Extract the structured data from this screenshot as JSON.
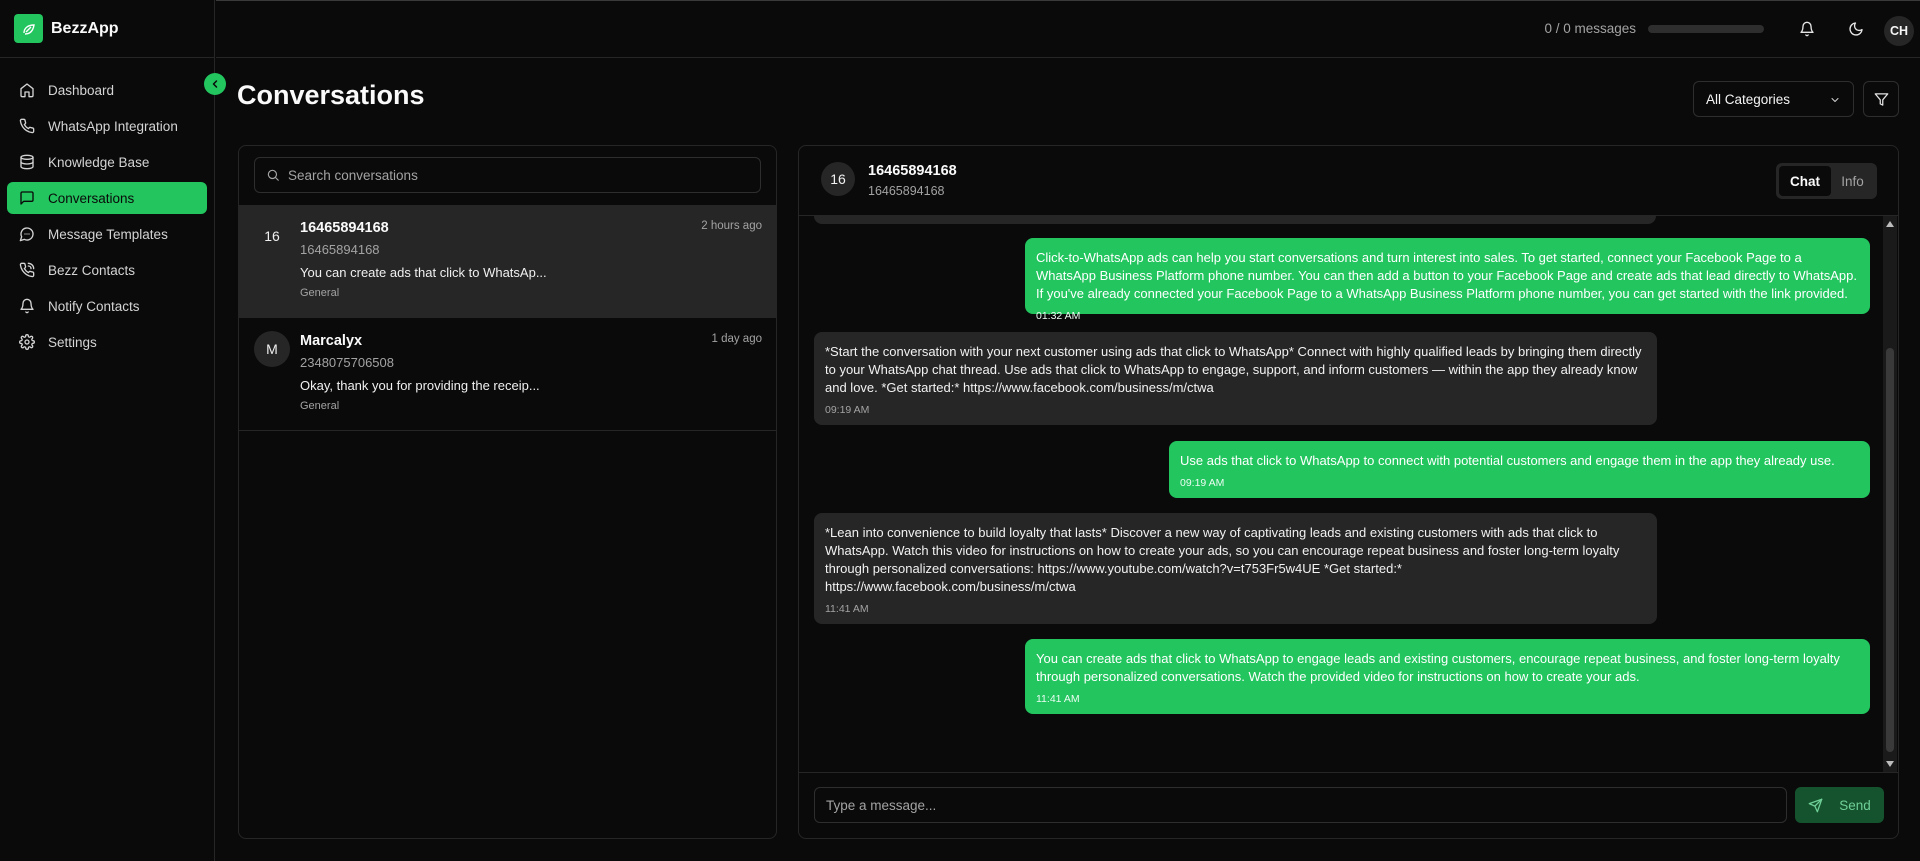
{
  "app": {
    "name": "BezzApp",
    "logo_icon": "leaf-chat-icon"
  },
  "colors": {
    "accent": "#22c55e",
    "background": "#0a0a0a",
    "surface": "#262626",
    "muted_text": "#a3a3a3"
  },
  "sidebar": {
    "items": [
      {
        "label": "Dashboard",
        "icon": "home-icon",
        "active": false
      },
      {
        "label": "WhatsApp Integration",
        "icon": "phone-icon",
        "active": false
      },
      {
        "label": "Knowledge Base",
        "icon": "database-icon",
        "active": false
      },
      {
        "label": "Conversations",
        "icon": "message-square-icon",
        "active": true
      },
      {
        "label": "Message Templates",
        "icon": "message-circle-icon",
        "active": false
      },
      {
        "label": "Bezz Contacts",
        "icon": "phone-call-icon",
        "active": false
      },
      {
        "label": "Notify Contacts",
        "icon": "bell-icon",
        "active": false
      },
      {
        "label": "Settings",
        "icon": "gear-icon",
        "active": false
      }
    ]
  },
  "topbar": {
    "usage_text": "0 / 0 messages",
    "usage_fraction": 0,
    "avatar_initials": "CH"
  },
  "page": {
    "title": "Conversations",
    "category_select": "All Categories"
  },
  "search": {
    "placeholder": "Search conversations",
    "value": ""
  },
  "conversations": [
    {
      "avatar": "16",
      "name": "16465894168",
      "phone": "16465894168",
      "preview": "You can create ads that click to WhatsAp...",
      "tag": "General",
      "time": "2 hours ago",
      "selected": true
    },
    {
      "avatar": "M",
      "name": "Marcalyx",
      "phone": "2348075706508",
      "preview": "Okay, thank you for providing the receip...",
      "tag": "General",
      "time": "1 day ago",
      "selected": false
    }
  ],
  "chat": {
    "avatar": "16",
    "name": "16465894168",
    "phone": "16465894168",
    "tabs": {
      "chat": "Chat",
      "info": "Info"
    },
    "messages": [
      {
        "direction": "out",
        "text": "Click-to-WhatsApp ads can help you start conversations and turn interest into sales. To get started, connect your Facebook Page to a WhatsApp Business Platform phone number. You can then add a button to your Facebook Page and create ads that lead directly to WhatsApp. If you've already connected your Facebook Page to a WhatsApp Business Platform phone number, you can get started with the link provided.",
        "time": "01:32 AM"
      },
      {
        "direction": "in",
        "text": "*Start the conversation with your next customer using ads that click to WhatsApp* Connect with highly qualified leads by bringing them directly to your WhatsApp chat thread. Use ads that click to WhatsApp to engage, support, and inform customers — within the app they already know and love. *Get started:* https://www.facebook.com/business/m/ctwa",
        "time": "09:19 AM"
      },
      {
        "direction": "out",
        "text": "Use ads that click to WhatsApp to connect with potential customers and engage them in the app they already use.",
        "time": "09:19 AM"
      },
      {
        "direction": "in",
        "text": "*Lean into convenience to build loyalty that lasts* Discover a new way of captivating leads and existing customers with ads that click to WhatsApp. Watch this video for instructions on how to create your ads, so you can encourage repeat business and foster long-term loyalty through personalized conversations: https://www.youtube.com/watch?v=t753Fr5w4UE *Get started:* https://www.facebook.com/business/m/ctwa",
        "time": "11:41 AM"
      },
      {
        "direction": "out",
        "text": "You can create ads that click to WhatsApp to engage leads and existing customers, encourage repeat business, and foster long-term loyalty through personalized conversations. Watch the provided video for instructions on how to create your ads.",
        "time": "11:41 AM"
      }
    ]
  },
  "composer": {
    "placeholder": "Type a message...",
    "value": "",
    "send_label": "Send"
  }
}
